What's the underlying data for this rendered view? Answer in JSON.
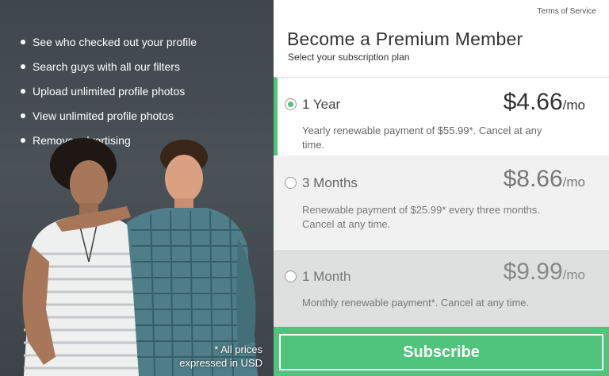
{
  "features": [
    "See who checked out your profile",
    "Search guys with all our filters",
    "Upload unlimited profile photos",
    "View unlimited profile photos",
    "Remove advertising"
  ],
  "footnote": {
    "line1": "* All prices",
    "line2": "expressed in USD"
  },
  "header": {
    "terms_link": "Terms of Service",
    "title": "Become a Premium Member",
    "subtitle": "Select your subscription plan"
  },
  "plans": [
    {
      "name": "1 Year",
      "price": "$4.66",
      "per": "/mo",
      "desc_line1": "Yearly renewable payment of $55.99*. Cancel at any time.",
      "desc_line2": "",
      "selected": true
    },
    {
      "name": "3 Months",
      "price": "$8.66",
      "per": "/mo",
      "desc_line1": "Renewable payment of $25.99* every three months.",
      "desc_line2": "Cancel at any time.",
      "selected": false
    },
    {
      "name": "1 Month",
      "price": "$9.99",
      "per": "/mo",
      "desc_line1": "Monthly renewable payment*. Cancel at any time.",
      "desc_line2": "",
      "selected": false
    }
  ],
  "subscribe_label": "Subscribe",
  "colors": {
    "accent": "#4fc47a",
    "left_bg": "#454c52"
  },
  "icons": {
    "radio_selected": "radio-checked",
    "radio_unselected": "radio-empty",
    "bullet": "bullet-dot"
  }
}
